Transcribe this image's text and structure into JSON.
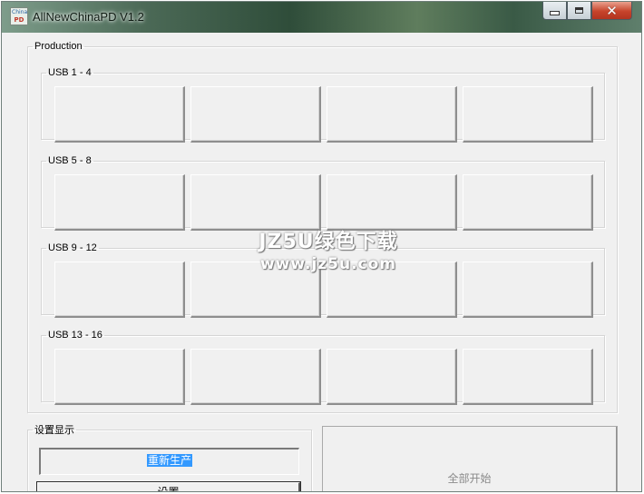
{
  "window": {
    "title": "AllNewChinaPD V1.2",
    "icon": {
      "name": "app-logo-icon",
      "top_text": "China",
      "bottom_text": "PD"
    },
    "controls": {
      "minimize": "minimize-icon",
      "maximize": "maximize-icon",
      "close": "close-icon"
    }
  },
  "production": {
    "label": "Production",
    "groups": [
      {
        "label": "USB 1 - 4"
      },
      {
        "label": "USB 5 - 8"
      },
      {
        "label": "USB 9 - 12"
      },
      {
        "label": "USB 13 - 16"
      }
    ]
  },
  "settings": {
    "label": "设置显示",
    "display_value": "重新生产",
    "settings_button": "设置"
  },
  "start_all_button": "全部开始",
  "watermark": {
    "line1": "JZ5U绿色下载",
    "line2": "www.jz5u.com"
  },
  "colors": {
    "selection": "#3399ff",
    "face": "#f0f0f0",
    "close_button": "#c7442b"
  }
}
